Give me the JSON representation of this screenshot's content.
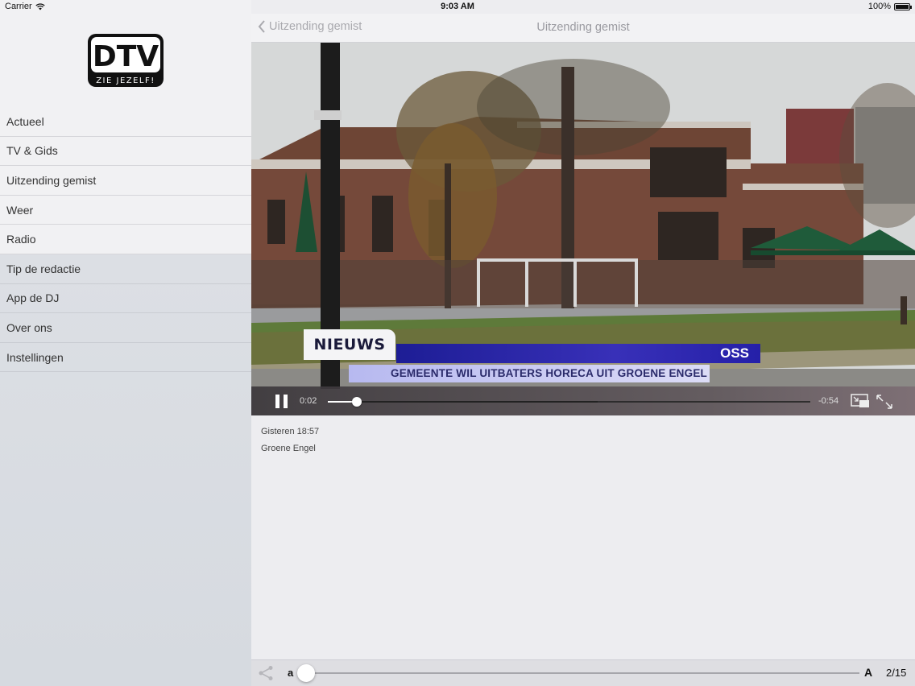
{
  "status_bar": {
    "carrier": "Carrier",
    "time": "9:03 AM",
    "battery": "100%"
  },
  "sidebar": {
    "logo": {
      "brand": "DTV",
      "tagline": "ZIE JEZELF!"
    },
    "items": [
      {
        "label": "Actueel"
      },
      {
        "label": "TV & Gids"
      },
      {
        "label": "Uitzending gemist"
      },
      {
        "label": "Weer"
      },
      {
        "label": "Radio"
      },
      {
        "label": "Tip de redactie"
      },
      {
        "label": "App de DJ"
      },
      {
        "label": "Over ons"
      },
      {
        "label": "Instellingen"
      }
    ]
  },
  "navbar": {
    "back_label": "Uitzending gemist",
    "title": "Uitzending gemist"
  },
  "video": {
    "overlay": {
      "tag": "NIEUWS",
      "location": "OSS",
      "headline": "GEMEENTE WIL UITBATERS HORECA UIT GROENE ENGEL"
    },
    "player": {
      "elapsed": "0:02",
      "remaining": "-0:54",
      "progress_fraction": 0.06,
      "buffered_fraction": 0.56
    }
  },
  "info": {
    "date": "Gisteren 18:57",
    "title": "Groene Engel"
  },
  "toolbar": {
    "font_small": "a",
    "font_large": "A",
    "font_size_fraction": 0.0,
    "page": "2/15"
  },
  "colors": {
    "accent_blue": "#2a26a8",
    "headline_bar": "#c8c9f3",
    "sidebar_top": "#f1f1f3",
    "sidebar_bottom": "#d9dce2"
  }
}
